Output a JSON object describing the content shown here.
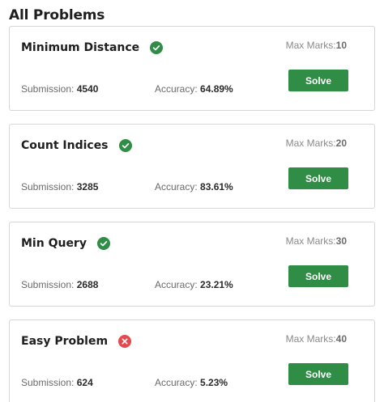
{
  "section_title": "All Problems",
  "labels": {
    "max_marks": "Max Marks:",
    "submission": "Submission:",
    "accuracy": "Accuracy:",
    "solve": "Solve"
  },
  "colors": {
    "solved": "#2f8d46",
    "unsolved": "#e5484d",
    "button": "#2f8d46"
  },
  "problems": [
    {
      "name": "Minimum Distance",
      "status": "check-icon",
      "max_marks": "10",
      "submissions": "4540",
      "accuracy": "64.89%"
    },
    {
      "name": "Count Indices",
      "status": "check-icon",
      "max_marks": "20",
      "submissions": "3285",
      "accuracy": "83.61%"
    },
    {
      "name": "Min Query",
      "status": "check-icon",
      "max_marks": "30",
      "submissions": "2688",
      "accuracy": "23.21%"
    },
    {
      "name": "Easy Problem",
      "status": "cross-icon",
      "max_marks": "40",
      "submissions": "624",
      "accuracy": "5.23%"
    }
  ]
}
